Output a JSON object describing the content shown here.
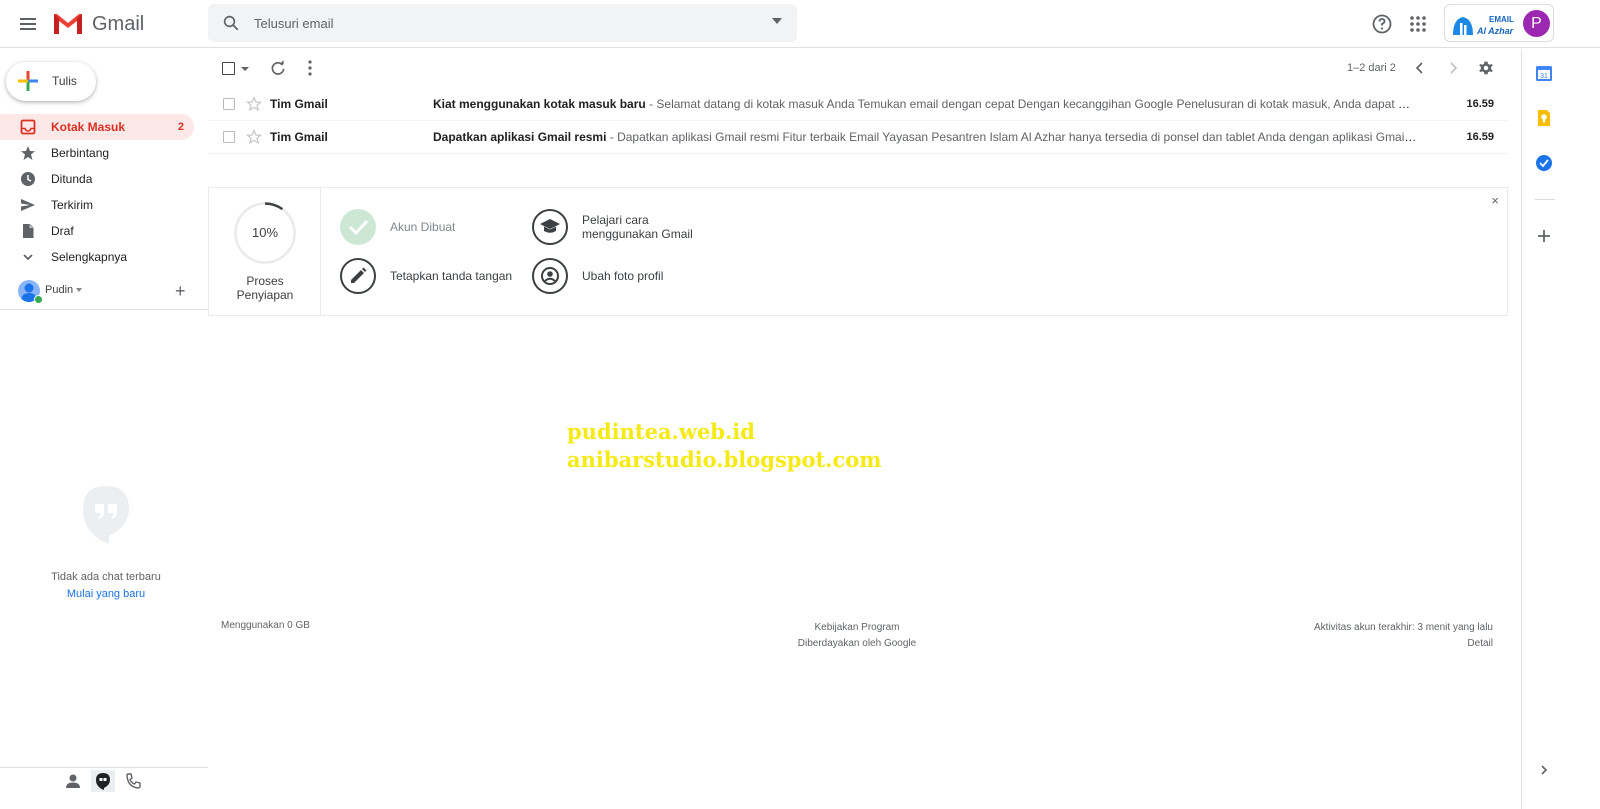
{
  "app": {
    "name": "Gmail"
  },
  "search": {
    "placeholder": "Telusuri email"
  },
  "compose": {
    "label": "Tulis"
  },
  "nav": {
    "items": [
      {
        "label": "Kotak Masuk",
        "count": "2",
        "icon": "inbox-icon"
      },
      {
        "label": "Berbintang",
        "icon": "star-icon"
      },
      {
        "label": "Ditunda",
        "icon": "clock-icon"
      },
      {
        "label": "Terkirim",
        "icon": "send-icon"
      },
      {
        "label": "Draf",
        "icon": "draft-icon"
      },
      {
        "label": "Selengkapnya",
        "icon": "chevron-down-icon"
      }
    ]
  },
  "hangouts": {
    "user": "Pudin",
    "empty_message": "Tidak ada chat terbaru",
    "start_link": "Mulai yang baru"
  },
  "account": {
    "initial": "P",
    "org_logo_line1": "EMAIL",
    "org_logo_line2": "Al Azhar"
  },
  "toolbar": {
    "pager": "1–2 dari 2"
  },
  "emails": [
    {
      "sender": "Tim Gmail",
      "subject": "Kiat menggunakan kotak masuk baru",
      "snippet": " - Selamat datang di kotak masuk Anda Temukan email dengan cepat Dengan kecanggihan Google Penelusuran di kotak masuk, Anda dapat mengarsi...",
      "time": "16.59"
    },
    {
      "sender": "Tim Gmail",
      "subject": "Dapatkan aplikasi Gmail resmi",
      "snippet": " - Dapatkan aplikasi Gmail resmi Fitur terbaik Email Yayasan Pesantren Islam Al Azhar hanya tersedia di ponsel dan tablet Anda dengan aplikasi Gmail resmi...",
      "time": "16.59"
    }
  ],
  "setup": {
    "progress": 10,
    "progress_text": "10%",
    "progress_label_1": "Proses",
    "progress_label_2": "Penyiapan",
    "tasks": [
      {
        "label": "Akun Dibuat",
        "done": true
      },
      {
        "label_1": "Pelajari cara",
        "label_2": "menggunakan Gmail",
        "done": false
      },
      {
        "label": "Tetapkan tanda tangan",
        "done": false
      },
      {
        "label": "Ubah foto profil",
        "done": false
      }
    ],
    "close": "×"
  },
  "watermark": {
    "line1": "pudintea.web.id",
    "line2": "anibarstudio.blogspot.com"
  },
  "footer": {
    "storage": "Menggunakan 0 GB",
    "policy": "Kebijakan Program",
    "powered": "Diberdayakan oleh Google",
    "activity": "Aktivitas akun terakhir: 3 menit yang lalu",
    "details": "Detail"
  },
  "colors": {
    "accent": "#d93025",
    "link": "#1a73e8",
    "watermark": "#f5ea14",
    "avatar": "#9c27b0"
  }
}
